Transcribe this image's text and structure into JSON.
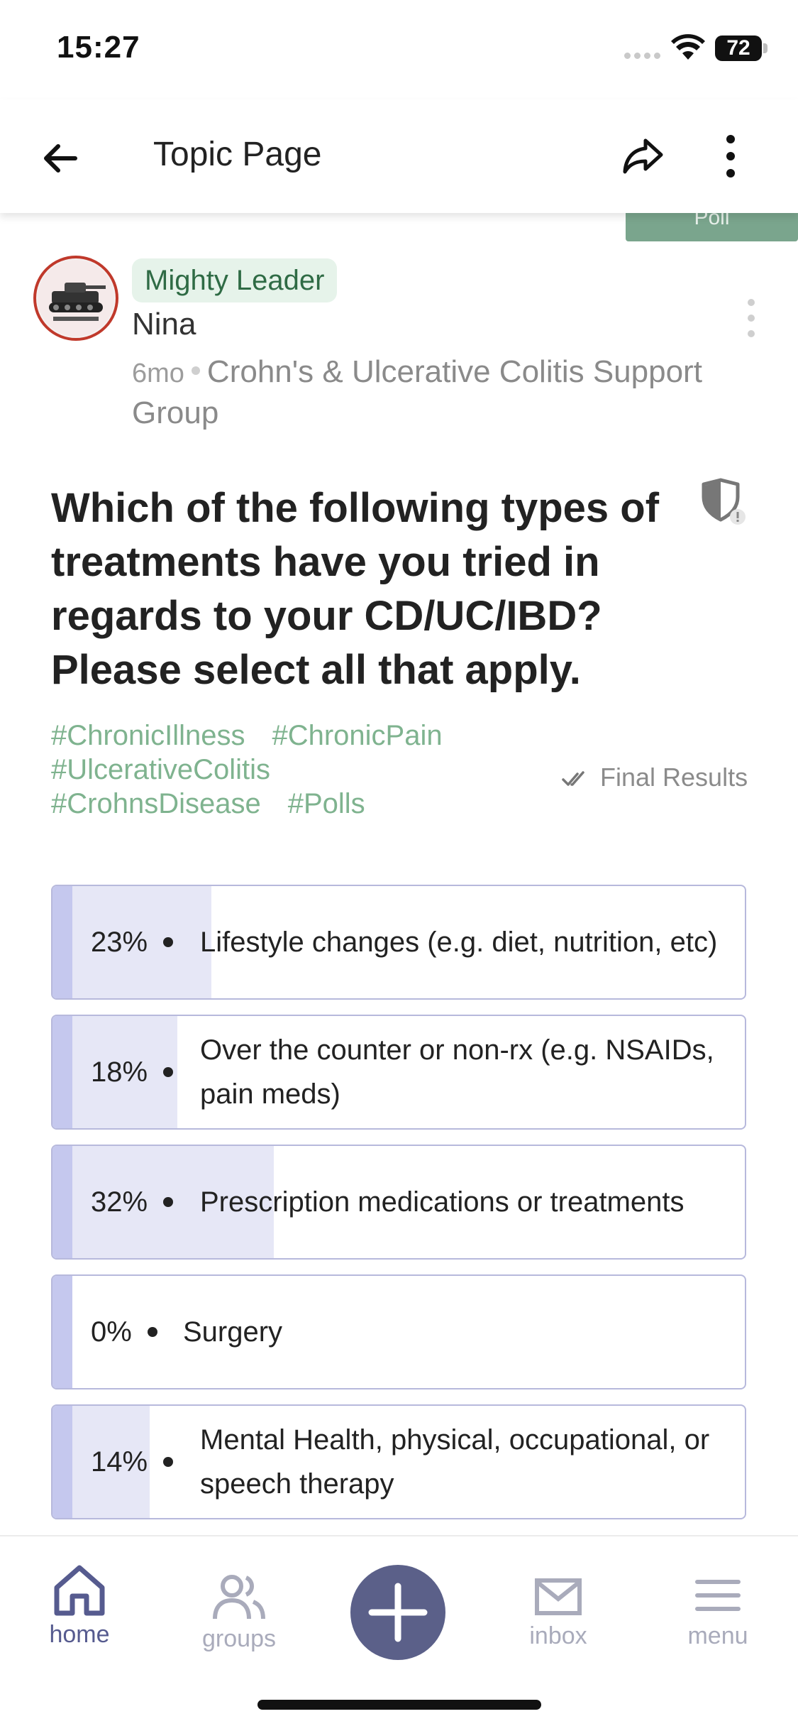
{
  "status": {
    "time": "15:27",
    "battery": "72"
  },
  "header": {
    "title": "Topic Page"
  },
  "poll_tab": "Poll",
  "post": {
    "badge": "Mighty Leader",
    "author": "Nina",
    "age": "6mo",
    "group": "Crohn's & Ulcerative Colitis Support Group",
    "question": "Which of the following types of treatments have you tried in regards to your CD/UC/IBD? Please select all that apply.",
    "tags": [
      "#ChronicIllness",
      "#ChronicPain",
      "#UlcerativeColitis",
      "#CrohnsDisease",
      "#Polls"
    ],
    "results_label": "Final Results"
  },
  "poll": {
    "options": [
      {
        "pct": "23%",
        "value": 23,
        "label": "Lifestyle changes (e.g. diet, nutrition, etc)"
      },
      {
        "pct": "18%",
        "value": 18,
        "label": "Over the counter or non-rx (e.g. NSAIDs, pain meds)"
      },
      {
        "pct": "32%",
        "value": 32,
        "label": "Prescription medications or treatments"
      },
      {
        "pct": "0%",
        "value": 0,
        "label": "Surgery"
      },
      {
        "pct": "14%",
        "value": 14,
        "label": "Mental Health, physical, occupational, or speech therapy"
      }
    ]
  },
  "nav": {
    "home": "home",
    "groups": "groups",
    "inbox": "inbox",
    "menu": "menu",
    "active": "home"
  },
  "colors": {
    "accent": "#5b6089",
    "tag": "#7fb38f",
    "badge_bg": "#e6f3ea",
    "badge_text": "#2f6b45"
  }
}
